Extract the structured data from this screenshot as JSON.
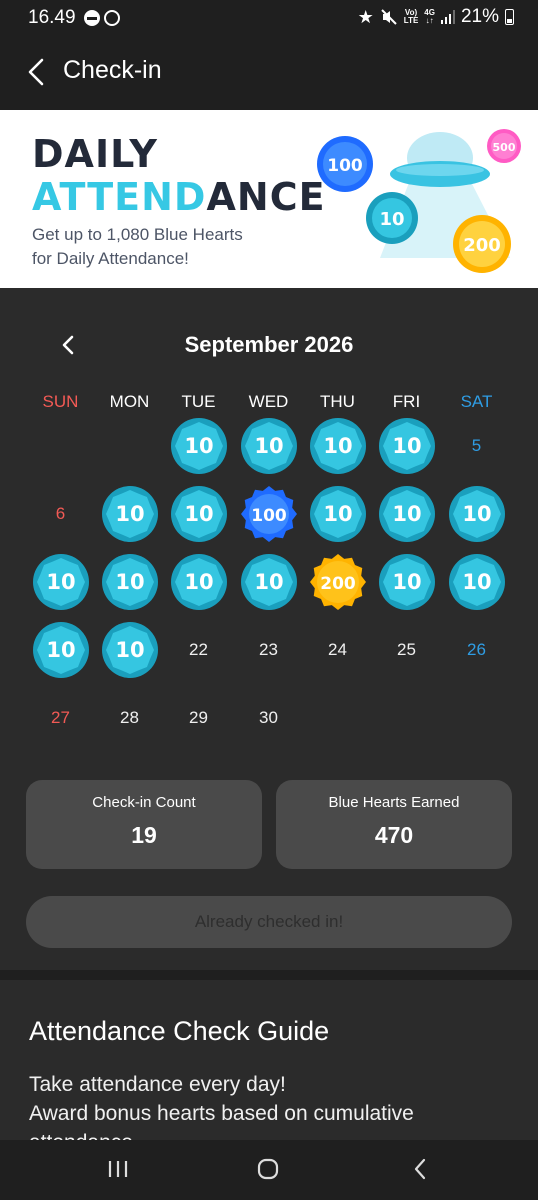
{
  "status_bar": {
    "time": "16.49",
    "network_top": "Vo)",
    "network_bottom": "LTE",
    "net_type": "4G",
    "battery": "21%"
  },
  "app_bar": {
    "title": "Check-in"
  },
  "banner": {
    "line1": "DAILY",
    "line2_highlight": "ATTEND",
    "line2_rest": "ANCE",
    "subtitle_line1": "Get up to 1,080 Blue Hearts",
    "subtitle_line2": "for Daily Attendance!",
    "badges": [
      "100",
      "500",
      "10",
      "200"
    ]
  },
  "calendar": {
    "month_label": "September 2026",
    "weekdays": [
      "SUN",
      "MON",
      "TUE",
      "WED",
      "THU",
      "FRI",
      "SAT"
    ],
    "weeks": [
      [
        null,
        null,
        {
          "badge": "10",
          "type": "teal"
        },
        {
          "badge": "10",
          "type": "teal"
        },
        {
          "badge": "10",
          "type": "teal"
        },
        {
          "badge": "10",
          "type": "teal"
        },
        {
          "day": "5"
        }
      ],
      [
        {
          "day": "6"
        },
        {
          "badge": "10",
          "type": "teal"
        },
        {
          "badge": "10",
          "type": "teal"
        },
        {
          "badge": "100",
          "type": "blue"
        },
        {
          "badge": "10",
          "type": "teal"
        },
        {
          "badge": "10",
          "type": "teal"
        },
        {
          "badge": "10",
          "type": "teal"
        }
      ],
      [
        {
          "badge": "10",
          "type": "teal"
        },
        {
          "badge": "10",
          "type": "teal"
        },
        {
          "badge": "10",
          "type": "teal"
        },
        {
          "badge": "10",
          "type": "teal"
        },
        {
          "badge": "200",
          "type": "gold"
        },
        {
          "badge": "10",
          "type": "teal"
        },
        {
          "badge": "10",
          "type": "teal"
        }
      ],
      [
        {
          "badge": "10",
          "type": "teal"
        },
        {
          "badge": "10",
          "type": "teal"
        },
        {
          "day": "22"
        },
        {
          "day": "23"
        },
        {
          "day": "24"
        },
        {
          "day": "25"
        },
        {
          "day": "26"
        }
      ],
      [
        {
          "day": "27"
        },
        {
          "day": "28"
        },
        {
          "day": "29"
        },
        {
          "day": "30"
        },
        null,
        null,
        null
      ]
    ]
  },
  "stats": {
    "checkin_label": "Check-in Count",
    "checkin_value": "19",
    "hearts_label": "Blue Hearts Earned",
    "hearts_value": "470"
  },
  "checkin_button": {
    "label": "Already checked in!"
  },
  "guide": {
    "title": "Attendance Check Guide",
    "line1": "Take attendance every day!",
    "line2": "Award bonus hearts based on cumulative",
    "line3": "attendance."
  },
  "colors": {
    "teal": "#35c6e1",
    "teal_dark": "#1a9fbd",
    "blue": "#1f6bff",
    "gold": "#ffc21a",
    "sunday": "#f25a55",
    "saturday": "#2f9de4"
  },
  "icons": [
    "back-arrow-icon",
    "calendar-prev-icon",
    "recent-apps-icon",
    "home-icon",
    "nav-back-icon",
    "star-icon",
    "mute-icon",
    "dnd-icon",
    "whatsapp-icon",
    "signal-icon",
    "battery-icon"
  ]
}
